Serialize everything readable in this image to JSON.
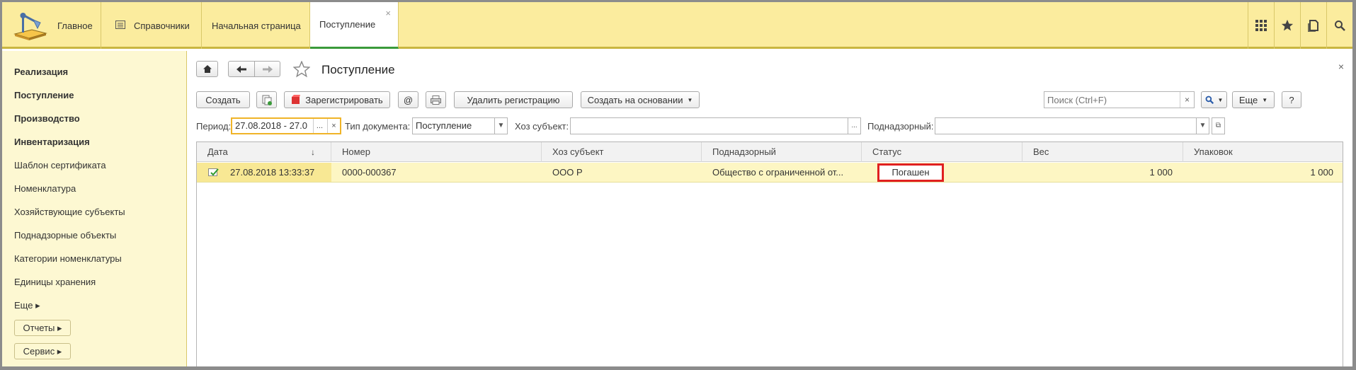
{
  "topbar": {
    "home_label": "Главное",
    "sprav_label": "Справочники",
    "tabs": [
      {
        "label": "Начальная страница"
      },
      {
        "label": "Поступление",
        "close": "×"
      }
    ],
    "icons": [
      "grid-icon",
      "star-icon",
      "history-icon",
      "search-icon"
    ]
  },
  "sidebar": {
    "items": [
      {
        "label": "Реализация",
        "bold": true
      },
      {
        "label": "Поступление",
        "bold": true
      },
      {
        "label": "Производство",
        "bold": true
      },
      {
        "label": "Инвентаризация",
        "bold": true
      },
      {
        "label": "Шаблон сертификата"
      },
      {
        "label": "Номенклатура"
      },
      {
        "label": "Хозяйствующие субъекты"
      },
      {
        "label": "Поднадзорные объекты"
      },
      {
        "label": "Категории номенклатуры"
      },
      {
        "label": "Единицы хранения"
      },
      {
        "label": "Еще ▸"
      }
    ],
    "buttons": [
      "Отчеты ▸",
      "Сервис ▸"
    ]
  },
  "form": {
    "title": "Поступление",
    "close": "×",
    "toolbar": {
      "create": "Создать",
      "register": "Зарегистрировать",
      "at": "@",
      "delete_reg": "Удалить регистрацию",
      "create_based": "Создать на основании",
      "search_placeholder": "Поиск (Ctrl+F)",
      "more": "Еще",
      "help": "?"
    },
    "filters": {
      "period_label": "Период:",
      "period_value": "27.08.2018 - 27.0",
      "doctype_label": "Тип документа:",
      "doctype_value": "Поступление",
      "subject_label": "Хоз субъект:",
      "subject_value": "",
      "supervised_label": "Поднадзорный:",
      "supervised_value": ""
    }
  },
  "table": {
    "columns": [
      "Дата",
      "Номер",
      "Хоз субъект",
      "Поднадзорный",
      "Статус",
      "Вес",
      "Упаковок"
    ],
    "rows": [
      {
        "date": "27.08.2018 13:33:37",
        "number": "0000-000367",
        "subject": "ООО  Р",
        "supervised": "Общество с ограниченной от...",
        "status": "Погашен",
        "weight": "1 000",
        "packages": "1 000"
      }
    ]
  },
  "colors": {
    "topbar": "#fbec9e",
    "sidebar": "#fdf8d2",
    "selected_row": "#fdf6c3",
    "highlight": "#e02020",
    "focus": "#f0b428"
  }
}
